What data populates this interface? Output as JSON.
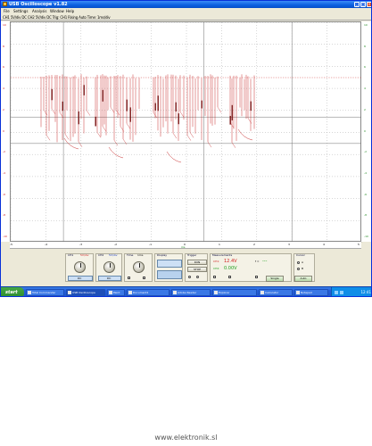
{
  "window": {
    "title": "USB Oscilloscope v1.82",
    "min_label": "_",
    "max_label": "□",
    "close_label": "×"
  },
  "menu": [
    "File",
    "Settings",
    "Analysis",
    "Window",
    "Help"
  ],
  "channel_strip": "CH1 5V/div  DC  CH2 5V/div  DC  Trig: CH1  Rising  Auto  Time: 1ms/div",
  "scope": {
    "left_scale": [
      "10",
      "8",
      "6",
      "4",
      "2",
      "0",
      "-2",
      "-4",
      "-6",
      "-8",
      "-10"
    ],
    "right_scale": [
      "10",
      "8",
      "6",
      "4",
      "2",
      "0",
      "-2",
      "-4",
      "-6",
      "-8",
      "-10"
    ],
    "time_ticks": [
      "-5",
      "-4",
      "-3",
      "-2",
      "-1",
      "0",
      "1",
      "2",
      "3",
      "4",
      "5"
    ],
    "time_unit": "ms"
  },
  "controls": {
    "ch1": {
      "title": "CH1",
      "value": "5V/div",
      "coupling": "DC"
    },
    "ch2": {
      "title": "CH2",
      "value": "5V/div",
      "coupling": "DC"
    },
    "timebase": {
      "title": "Time",
      "value": "1ms"
    },
    "display": {
      "title": "Display"
    },
    "trigger": {
      "title": "Trigger",
      "run": "RUN",
      "stop": "STOP"
    },
    "measure": {
      "title": "Measurements",
      "ch1_label": "CH1:",
      "ch1_value": "12.4V",
      "ch2_label": "CH2:",
      "ch2_value": "0.00V",
      "freq_label": "f =",
      "freq_value": "---"
    },
    "readout": {
      "title": "Cursor",
      "a": "A",
      "b": "B"
    },
    "buttons": {
      "single": "Single",
      "auto": "Auto"
    }
  },
  "taskbar": {
    "start_label": "start",
    "tasks": [
      "Total Commander",
      "USB Oscilloscope",
      "Paint",
      "Document1",
      "Adobe Reader",
      "Explorer",
      "Calculator",
      "Notepad"
    ],
    "clock": "12:41"
  },
  "watermark": "www.elektronik.sl"
}
